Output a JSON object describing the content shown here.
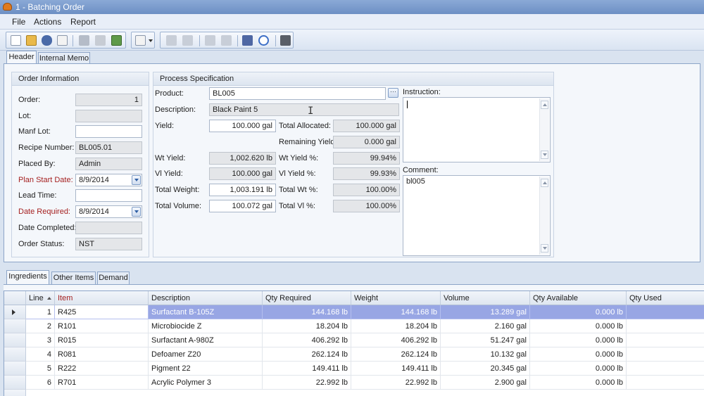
{
  "window": {
    "title": "1 - Batching Order"
  },
  "menu": [
    "File",
    "Actions",
    "Report"
  ],
  "toolbar": {
    "icons": [
      "new-icon",
      "open-icon",
      "find-icon",
      "properties-icon",
      "save-icon",
      "delete-icon",
      "export-icon",
      "print-preview-icon",
      "copy-icon",
      "paste-icon",
      "list-icon",
      "report-icon",
      "approve-icon",
      "check-icon",
      "calculator-icon"
    ]
  },
  "tabs_top": [
    "Header",
    "Internal Memo"
  ],
  "order_info": {
    "title": "Order Information",
    "labels": {
      "order": "Order:",
      "lot": "Lot:",
      "manf_lot": "Manf Lot:",
      "recipe": "Recipe Number:",
      "placed_by": "Placed By:",
      "plan_start": "Plan Start Date:",
      "lead_time": "Lead Time:",
      "date_required": "Date Required:",
      "date_completed": "Date Completed:",
      "order_status": "Order Status:"
    },
    "values": {
      "order": "1",
      "lot": "",
      "manf_lot": "",
      "recipe": "BL005.01",
      "placed_by": "Admin",
      "plan_start": "8/9/2014",
      "lead_time": "",
      "date_required": "8/9/2014",
      "date_completed": "",
      "order_status": "NST"
    }
  },
  "process_spec": {
    "title": "Process Specification",
    "labels": {
      "product": "Product:",
      "description": "Description:",
      "yield": "Yield:",
      "wt_yield": "Wt Yield:",
      "vl_yield": "Vl Yield:",
      "total_weight": "Total Weight:",
      "total_volume": "Total Volume:",
      "total_allocated": "Total Allocated:",
      "remaining_yield": "Remaining Yield:",
      "wt_yield_pct": "Wt Yield %:",
      "vl_yield_pct": "Vl Yield %:",
      "total_wt_pct": "Total Wt %:",
      "total_vl_pct": "Total Vl %:",
      "instruction": "Instruction:",
      "comment": "Comment:"
    },
    "values": {
      "product": "BL005",
      "description": "Black Paint 5",
      "yield": "100.000 gal",
      "wt_yield": "1,002.620 lb",
      "vl_yield": "100.000 gal",
      "total_weight": "1,003.191 lb",
      "total_volume": "100.072 gal",
      "total_allocated": "100.000 gal",
      "remaining_yield": "0.000 gal",
      "wt_yield_pct": "99.94%",
      "vl_yield_pct": "99.93%",
      "total_wt_pct": "100.00%",
      "total_vl_pct": "100.00%",
      "instruction": "",
      "comment": "bl005"
    }
  },
  "tabs_bottom": [
    "Ingredients",
    "Other Items",
    "Demand"
  ],
  "grid": {
    "columns": [
      "Line",
      "Item",
      "Description",
      "Qty Required",
      "Weight",
      "Volume",
      "Qty Available",
      "Qty Used"
    ],
    "rows": [
      {
        "line": "1",
        "item": "R425",
        "description": "Surfactant B-105Z",
        "qty_required": "144.168 lb",
        "weight": "144.168 lb",
        "volume": "13.289 gal",
        "qty_available": "0.000 lb",
        "qty_used": ""
      },
      {
        "line": "2",
        "item": "R101",
        "description": "Microbiocide Z",
        "qty_required": "18.204 lb",
        "weight": "18.204 lb",
        "volume": "2.160 gal",
        "qty_available": "0.000 lb",
        "qty_used": ""
      },
      {
        "line": "3",
        "item": "R015",
        "description": "Surfactant A-980Z",
        "qty_required": "406.292 lb",
        "weight": "406.292 lb",
        "volume": "51.247 gal",
        "qty_available": "0.000 lb",
        "qty_used": ""
      },
      {
        "line": "4",
        "item": "R081",
        "description": "Defoamer Z20",
        "qty_required": "262.124 lb",
        "weight": "262.124 lb",
        "volume": "10.132 gal",
        "qty_available": "0.000 lb",
        "qty_used": ""
      },
      {
        "line": "5",
        "item": "R222",
        "description": "Pigment 22",
        "qty_required": "149.411 lb",
        "weight": "149.411 lb",
        "volume": "20.345 gal",
        "qty_available": "0.000 lb",
        "qty_used": ""
      },
      {
        "line": "6",
        "item": "R701",
        "description": "Acrylic Polymer 3",
        "qty_required": "22.992 lb",
        "weight": "22.992 lb",
        "volume": "2.900 gal",
        "qty_available": "0.000 lb",
        "qty_used": ""
      }
    ]
  }
}
